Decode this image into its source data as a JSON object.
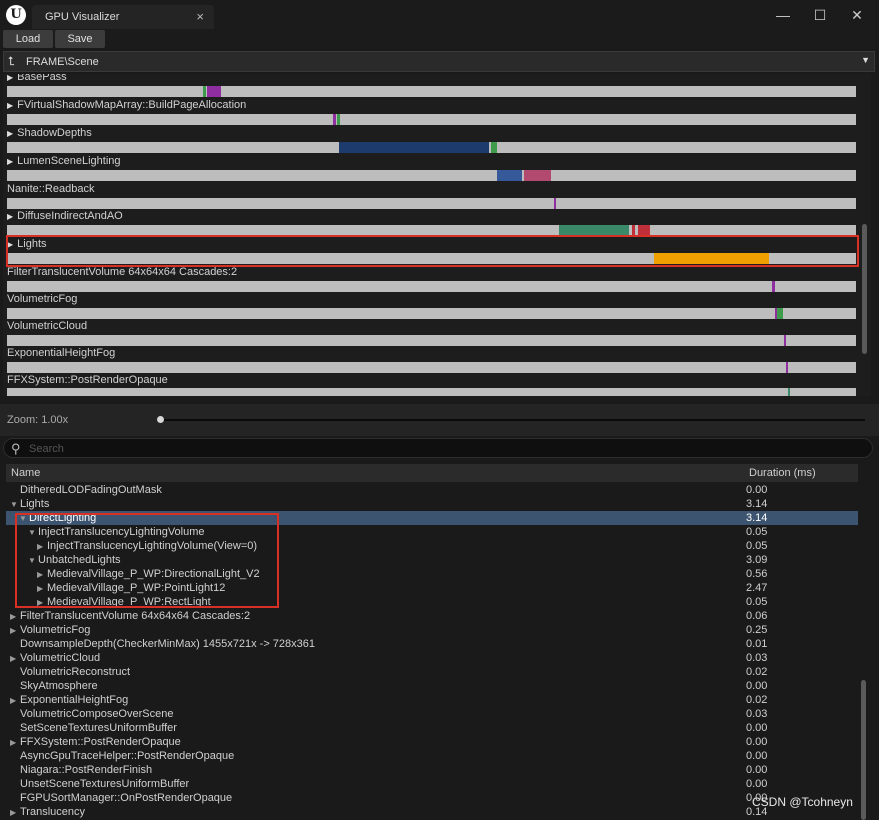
{
  "window": {
    "logo": "U",
    "tab_title": "GPU Visualizer",
    "close_glyph": "×",
    "minimize_glyph": "—",
    "maximize_glyph": "☐",
    "window_close_glyph": "✕"
  },
  "toolbar": {
    "load_label": "Load",
    "save_label": "Save"
  },
  "breadcrumb": {
    "icon": "⮤",
    "path": "FRAME\\Scene",
    "dropdown": "▼"
  },
  "timeline": {
    "items": [
      {
        "label": "BasePass",
        "expandable": true
      },
      {
        "label": "FVirtualShadowMapArray::BuildPageAllocation",
        "expandable": true
      },
      {
        "label": "ShadowDepths",
        "expandable": true
      },
      {
        "label": "LumenSceneLighting",
        "expandable": true
      },
      {
        "label": "Nanite::Readback",
        "expandable": false
      },
      {
        "label": "DiffuseIndirectAndAO",
        "expandable": true
      },
      {
        "label": "Lights",
        "expandable": true
      },
      {
        "label": "FilterTranslucentVolume 64x64x64 Cascades:2",
        "expandable": false
      },
      {
        "label": "VolumetricFog",
        "expandable": false
      },
      {
        "label": "VolumetricCloud",
        "expandable": false
      },
      {
        "label": "ExponentialHeightFog",
        "expandable": false
      },
      {
        "label": "FFXSystem::PostRenderOpaque",
        "expandable": false
      }
    ],
    "colors": {
      "purple": "#8e2ea0",
      "green": "#3e9b4b",
      "navy": "#1e3b6e",
      "blue": "#36599a",
      "pink": "#b14a6e",
      "teal": "#3a8a6a",
      "orange": "#f0a000",
      "red": "#c0303a"
    }
  },
  "zoom": {
    "label": "Zoom: 1.00x"
  },
  "search": {
    "placeholder": "Search"
  },
  "table": {
    "col_name": "Name",
    "col_duration": "Duration (ms)",
    "rows": [
      {
        "name": "DitheredLODFadingOutMask",
        "duration": "0.00",
        "depth": 0,
        "toggle": ""
      },
      {
        "name": "Lights",
        "duration": "3.14",
        "depth": 0,
        "toggle": "▼"
      },
      {
        "name": "DirectLighting",
        "duration": "3.14",
        "depth": 1,
        "toggle": "▼",
        "selected": true
      },
      {
        "name": "InjectTranslucencyLightingVolume",
        "duration": "0.05",
        "depth": 2,
        "toggle": "▼"
      },
      {
        "name": "InjectTranslucencyLightingVolume(View=0)",
        "duration": "0.05",
        "depth": 3,
        "toggle": "▶"
      },
      {
        "name": "UnbatchedLights",
        "duration": "3.09",
        "depth": 2,
        "toggle": "▼"
      },
      {
        "name": "MedievalVillage_P_WP:DirectionalLight_V2",
        "duration": "0.56",
        "depth": 3,
        "toggle": "▶"
      },
      {
        "name": "MedievalVillage_P_WP:PointLight12",
        "duration": "2.47",
        "depth": 3,
        "toggle": "▶"
      },
      {
        "name": "MedievalVillage_P_WP:RectLight",
        "duration": "0.05",
        "depth": 3,
        "toggle": "▶"
      },
      {
        "name": "FilterTranslucentVolume 64x64x64 Cascades:2",
        "duration": "0.06",
        "depth": 0,
        "toggle": "▶"
      },
      {
        "name": "VolumetricFog",
        "duration": "0.25",
        "depth": 0,
        "toggle": "▶"
      },
      {
        "name": "DownsampleDepth(CheckerMinMax) 1455x721x -> 728x361",
        "duration": "0.01",
        "depth": 0,
        "toggle": ""
      },
      {
        "name": "VolumetricCloud",
        "duration": "0.03",
        "depth": 0,
        "toggle": "▶"
      },
      {
        "name": "VolumetricReconstruct",
        "duration": "0.02",
        "depth": 0,
        "toggle": ""
      },
      {
        "name": "SkyAtmosphere",
        "duration": "0.00",
        "depth": 0,
        "toggle": ""
      },
      {
        "name": "ExponentialHeightFog",
        "duration": "0.02",
        "depth": 0,
        "toggle": "▶"
      },
      {
        "name": "VolumetricComposeOverScene",
        "duration": "0.03",
        "depth": 0,
        "toggle": ""
      },
      {
        "name": "SetSceneTexturesUniformBuffer",
        "duration": "0.00",
        "depth": 0,
        "toggle": ""
      },
      {
        "name": "FFXSystem::PostRenderOpaque",
        "duration": "0.00",
        "depth": 0,
        "toggle": "▶"
      },
      {
        "name": "AsyncGpuTraceHelper::PostRenderOpaque",
        "duration": "0.00",
        "depth": 0,
        "toggle": ""
      },
      {
        "name": "Niagara::PostRenderFinish",
        "duration": "0.00",
        "depth": 0,
        "toggle": ""
      },
      {
        "name": "UnsetSceneTexturesUniformBuffer",
        "duration": "0.00",
        "depth": 0,
        "toggle": ""
      },
      {
        "name": "FGPUSortManager::OnPostRenderOpaque",
        "duration": "0.00",
        "depth": 0,
        "toggle": ""
      },
      {
        "name": "Translucency",
        "duration": "0.14",
        "depth": 0,
        "toggle": "▶"
      }
    ]
  },
  "watermark": "CSDN @Tcohneyn"
}
